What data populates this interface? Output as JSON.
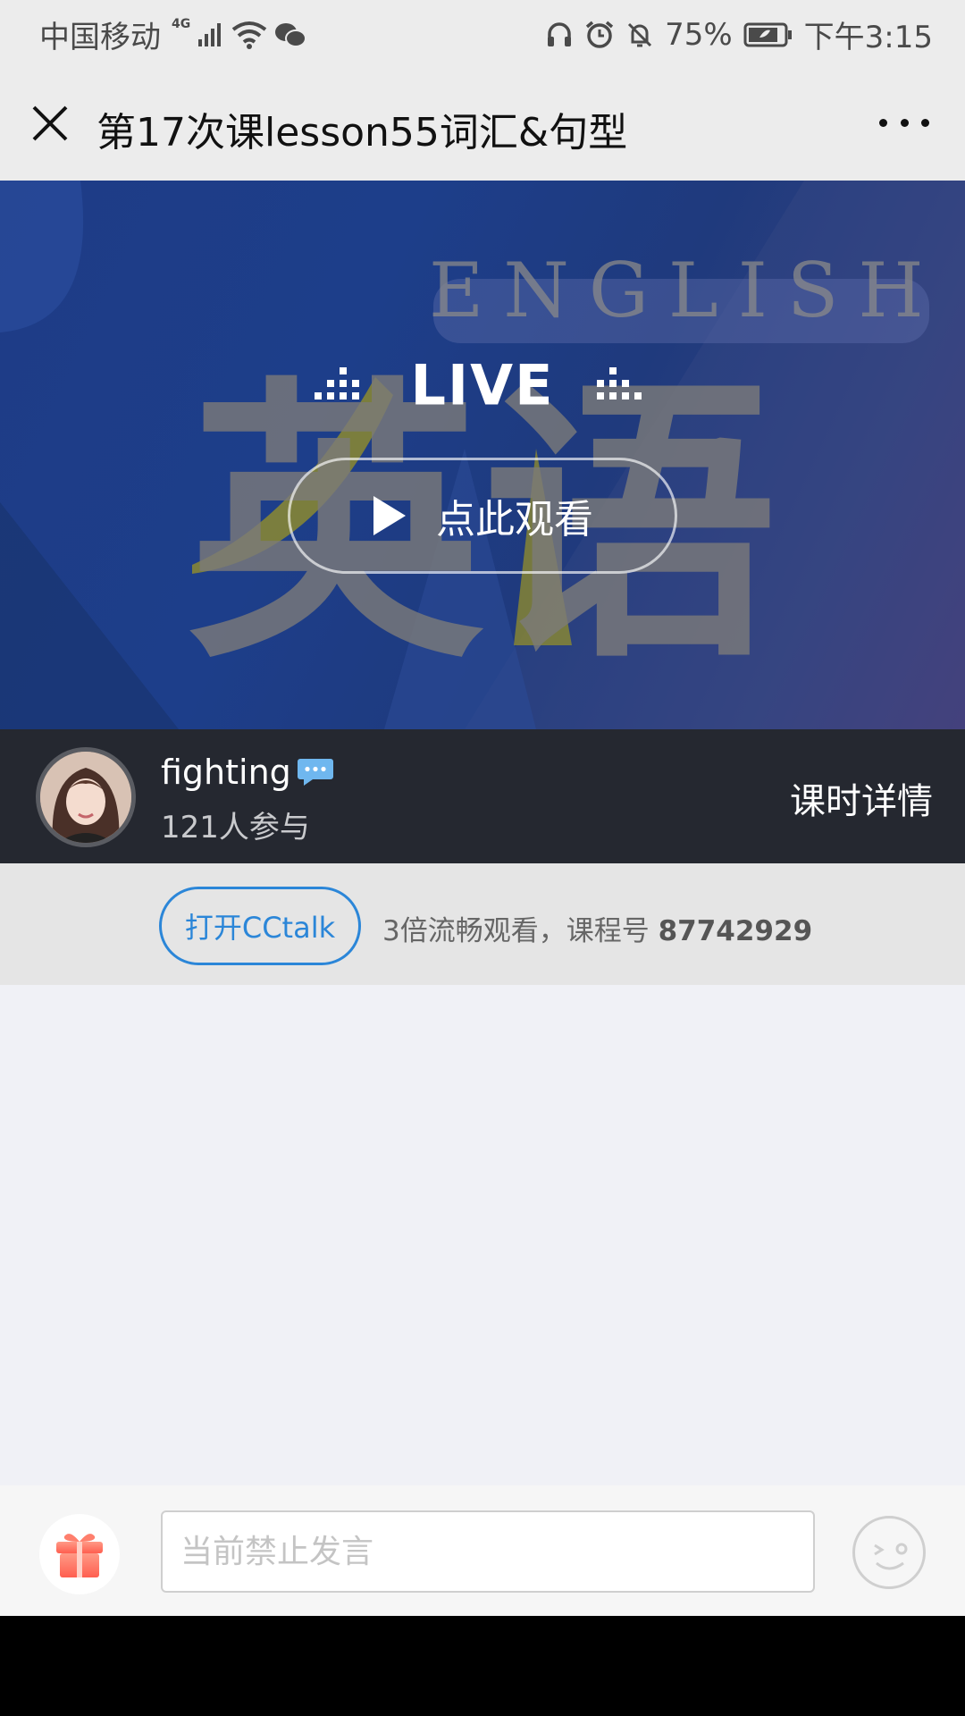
{
  "status_bar": {
    "carrier": "中国移动",
    "network": "4G",
    "battery": "75%",
    "time": "下午3:15",
    "icons": [
      "signal-icon",
      "wifi-icon",
      "wechat-icon",
      "headphones-icon",
      "alarm-icon",
      "mute-icon",
      "battery-icon"
    ]
  },
  "header": {
    "title": "第17次课lesson55词汇&句型",
    "close_icon": "close-icon",
    "more_icon": "more-icon"
  },
  "banner": {
    "live_label": "LIVE",
    "watch_label": "点此观看",
    "bg_chinese": "英语",
    "bg_english": "ENGLISH"
  },
  "host": {
    "name": "fighting",
    "participants": "121人参与",
    "detail_link": "课时详情"
  },
  "promo": {
    "open_button": "打开CCtalk",
    "text": "3倍流畅观看，课程号 ",
    "course_number": "87742929"
  },
  "input_bar": {
    "placeholder": "当前禁止发言",
    "gift_icon": "gift-icon",
    "emoji_icon": "emoji-icon"
  },
  "colors": {
    "accent": "#2b86d8",
    "host_bar": "#252830",
    "banner_blue": "#1e3c86"
  }
}
